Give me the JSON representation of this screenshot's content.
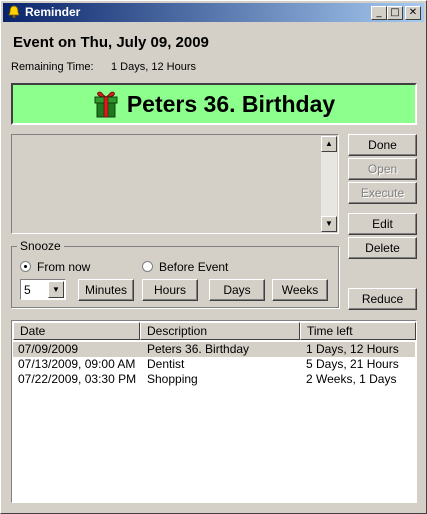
{
  "window": {
    "title": "Reminder",
    "controls": {
      "minimize": "_",
      "maximize": "□",
      "close": "✕"
    }
  },
  "event": {
    "title": "Event on Thu, July 09, 2009",
    "remaining_label": "Remaining Time:",
    "remaining_value": "1 Days, 12 Hours",
    "banner_text": "Peters 36. Birthday",
    "banner_color": "#8cff8c",
    "banner_icon": "gift-icon"
  },
  "buttons": {
    "done": "Done",
    "open": "Open",
    "execute": "Execute",
    "edit": "Edit",
    "delete": "Delete",
    "reduce": "Reduce"
  },
  "snooze": {
    "label": "Snooze",
    "from_now": "From now",
    "before_event": "Before Event",
    "selected": "From now",
    "amount": "5",
    "units": [
      "Minutes",
      "Hours",
      "Days",
      "Weeks"
    ]
  },
  "list": {
    "columns": [
      "Date",
      "Description",
      "Time left"
    ],
    "rows": [
      [
        "07/09/2009",
        "Peters 36. Birthday",
        "1 Days, 12 Hours"
      ],
      [
        "07/13/2009, 09:00 AM",
        "Dentist",
        "5 Days, 21 Hours"
      ],
      [
        "07/22/2009, 03:30 PM",
        "Shopping",
        "2 Weeks, 1 Days"
      ]
    ],
    "selected_row": 0
  }
}
